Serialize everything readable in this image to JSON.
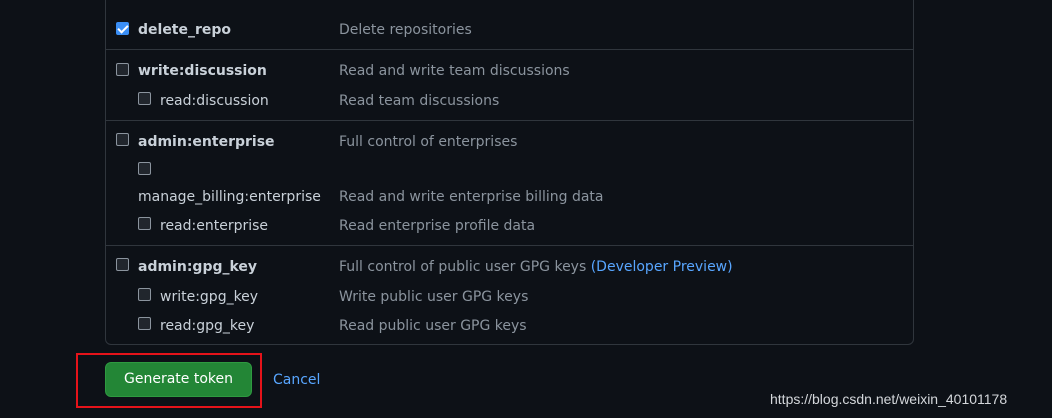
{
  "scopes": [
    {
      "name": "delete_repo",
      "description": "Delete repositories",
      "checked": true
    },
    {
      "name": "write:discussion",
      "description": "Read and write team discussions",
      "checked": false
    },
    {
      "name": "read:discussion",
      "description": "Read team discussions",
      "checked": false
    },
    {
      "name": "admin:enterprise",
      "description": "Full control of enterprises",
      "checked": false
    },
    {
      "name": "manage_billing:enterprise",
      "description": "Read and write enterprise billing data",
      "checked": false
    },
    {
      "name": "read:enterprise",
      "description": "Read enterprise profile data",
      "checked": false
    },
    {
      "name": "admin:gpg_key",
      "description": "Full control of public user GPG keys",
      "description_link": "(Developer Preview)",
      "checked": false
    },
    {
      "name": "write:gpg_key",
      "description": "Write public user GPG keys",
      "checked": false
    },
    {
      "name": "read:gpg_key",
      "description": "Read public user GPG keys",
      "checked": false
    }
  ],
  "actions": {
    "generate_label": "Generate token",
    "cancel_label": "Cancel"
  },
  "watermark": "https://blog.csdn.net/weixin_40101178",
  "colors": {
    "background": "#0d1117",
    "border": "#30363d",
    "primary_button": "#238636",
    "link": "#58a6ff",
    "checkbox_checked": "#3a8ef5",
    "highlight_box": "#e5131a"
  }
}
